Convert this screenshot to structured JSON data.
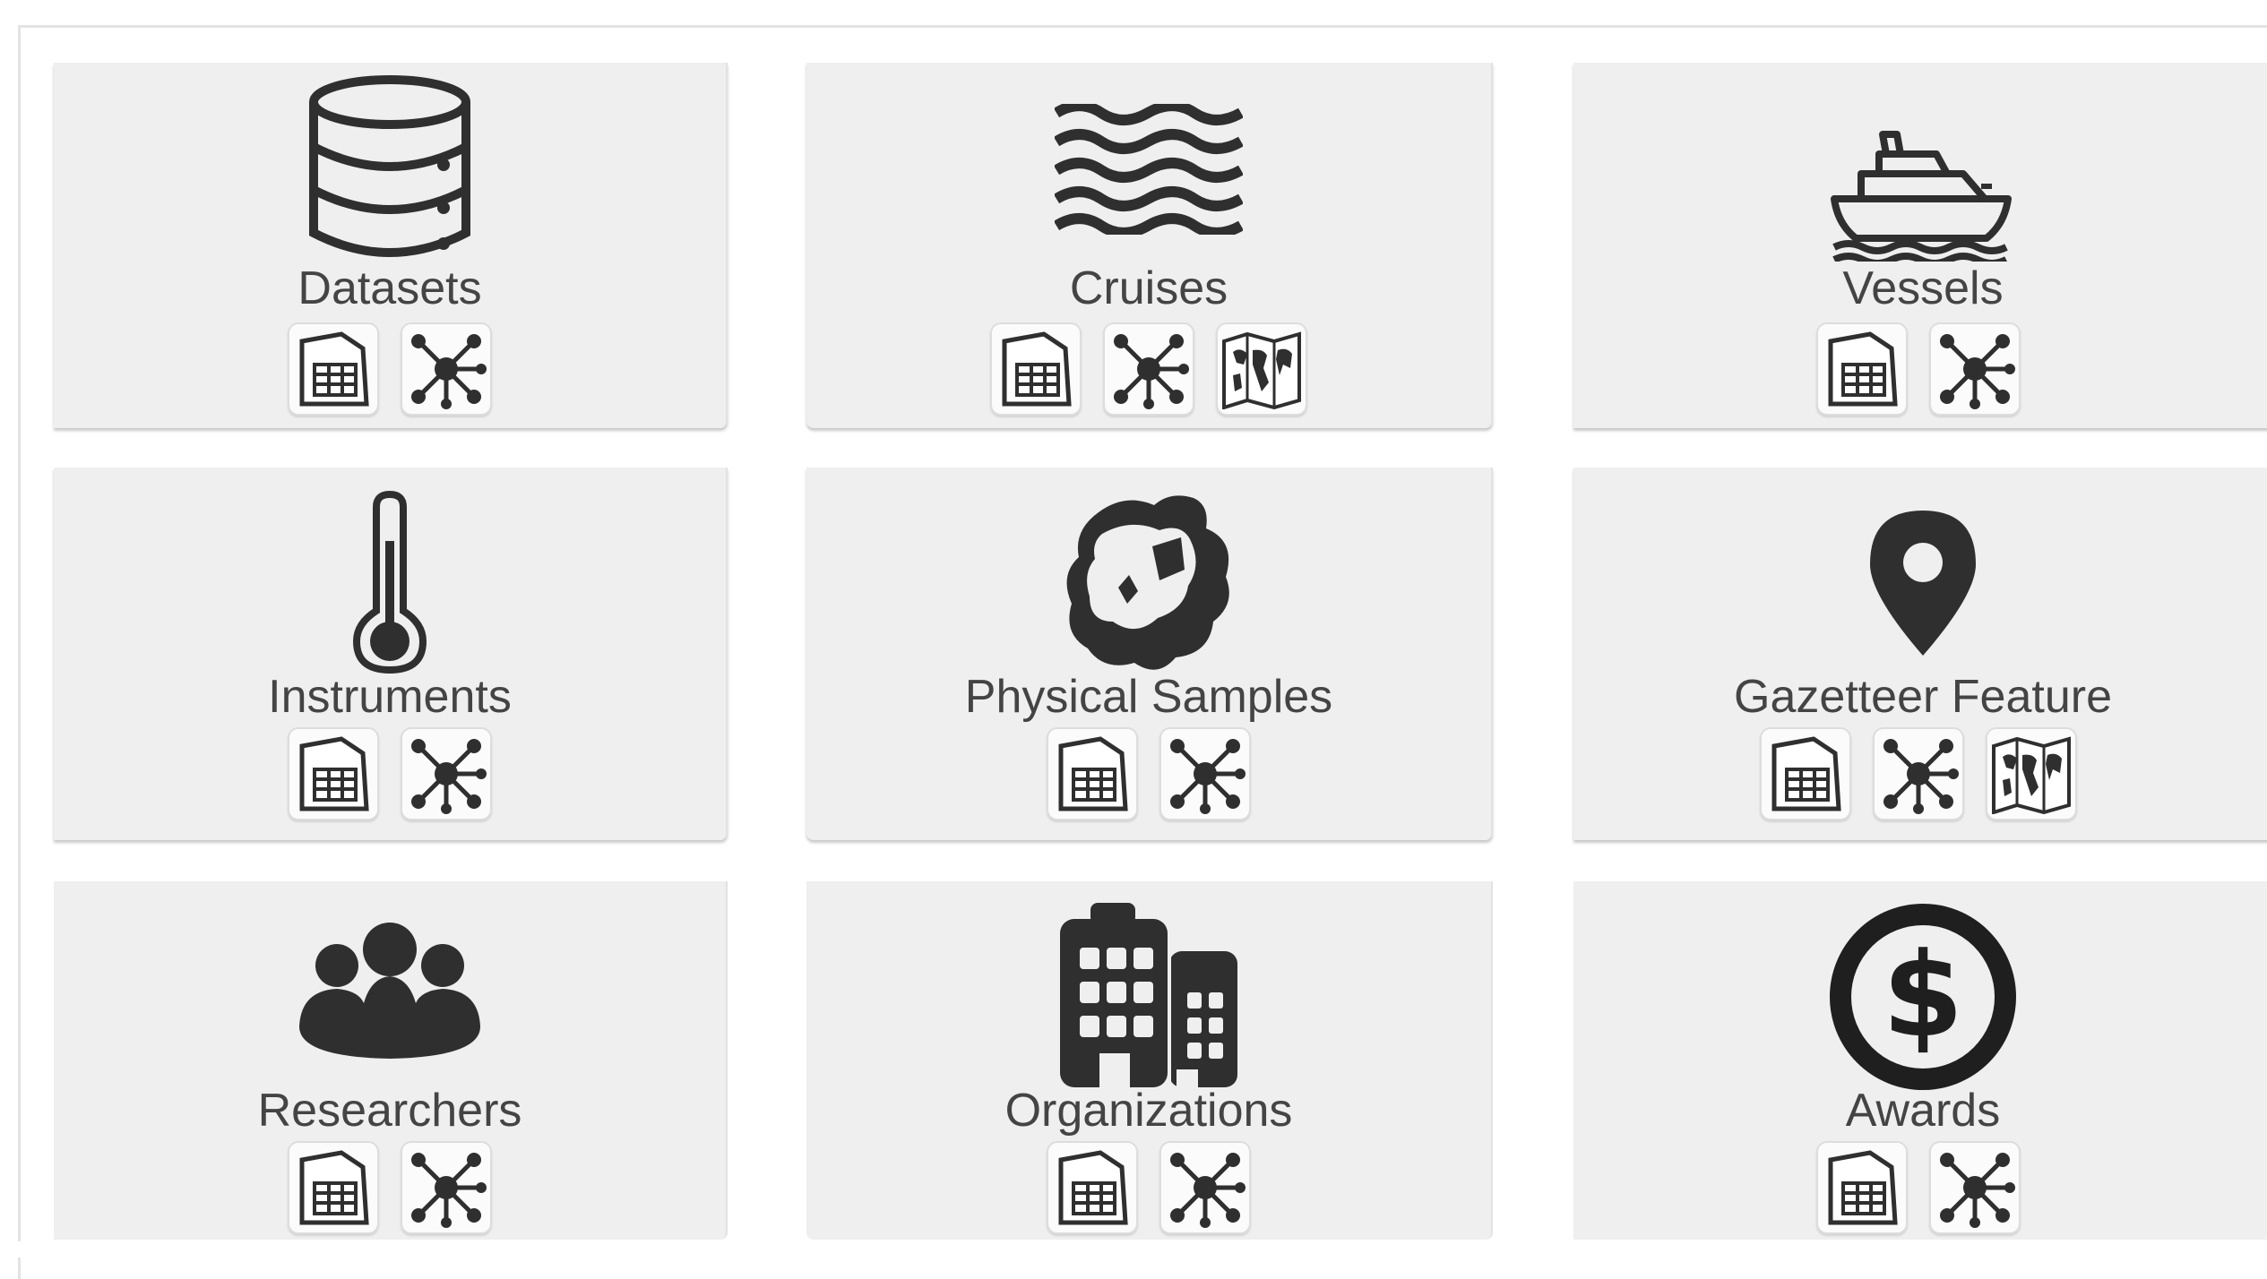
{
  "tiles": [
    {
      "label": "Datasets",
      "icon": "database-icon",
      "actions": [
        "table-icon",
        "network-graph-icon"
      ]
    },
    {
      "label": "Cruises",
      "icon": "waves-icon",
      "actions": [
        "table-icon",
        "network-graph-icon",
        "world-map-icon"
      ]
    },
    {
      "label": "Vessels",
      "icon": "ship-icon",
      "actions": [
        "table-icon",
        "network-graph-icon"
      ]
    },
    {
      "label": "Instruments",
      "icon": "thermometer-icon",
      "actions": [
        "table-icon",
        "network-graph-icon"
      ]
    },
    {
      "label": "Physical Samples",
      "icon": "rock-sample-icon",
      "actions": [
        "table-icon",
        "network-graph-icon"
      ]
    },
    {
      "label": "Gazetteer Feature",
      "icon": "map-pin-icon",
      "actions": [
        "table-icon",
        "network-graph-icon",
        "world-map-icon"
      ]
    },
    {
      "label": "Researchers",
      "icon": "people-group-icon",
      "actions": [
        "table-icon",
        "network-graph-icon"
      ]
    },
    {
      "label": "Organizations",
      "icon": "buildings-icon",
      "actions": [
        "table-icon",
        "network-graph-icon"
      ]
    },
    {
      "label": "Awards",
      "icon": "dollar-circle-icon",
      "actions": [
        "table-icon",
        "network-graph-icon"
      ]
    }
  ],
  "colors": {
    "icon": "#2f2f2f",
    "tile_bg": "#efefef",
    "label": "#444444"
  }
}
